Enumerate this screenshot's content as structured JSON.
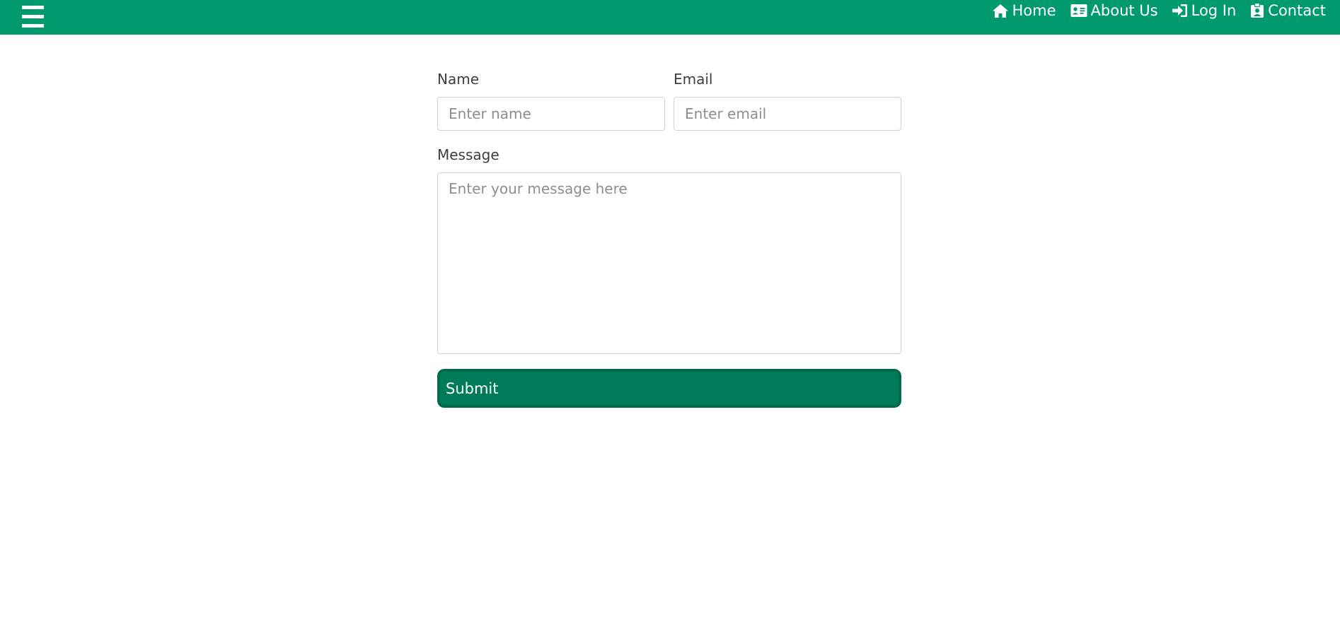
{
  "colors": {
    "navbar": "#009a6e",
    "submit_bg": "#007b5a",
    "submit_border": "#006a4d",
    "text": "#3a3f44"
  },
  "nav": {
    "menu_icon": "hamburger-icon",
    "links": [
      {
        "icon": "home-icon",
        "label": "Home"
      },
      {
        "icon": "id-card-icon",
        "label": "About Us"
      },
      {
        "icon": "sign-in-icon",
        "label": "Log In"
      },
      {
        "icon": "id-badge-icon",
        "label": "Contact"
      }
    ]
  },
  "form": {
    "name": {
      "label": "Name",
      "placeholder": "Enter name",
      "value": ""
    },
    "email": {
      "label": "Email",
      "placeholder": "Enter email",
      "value": ""
    },
    "message": {
      "label": "Message",
      "placeholder": "Enter your message here",
      "value": ""
    },
    "submit_label": "Submit"
  }
}
